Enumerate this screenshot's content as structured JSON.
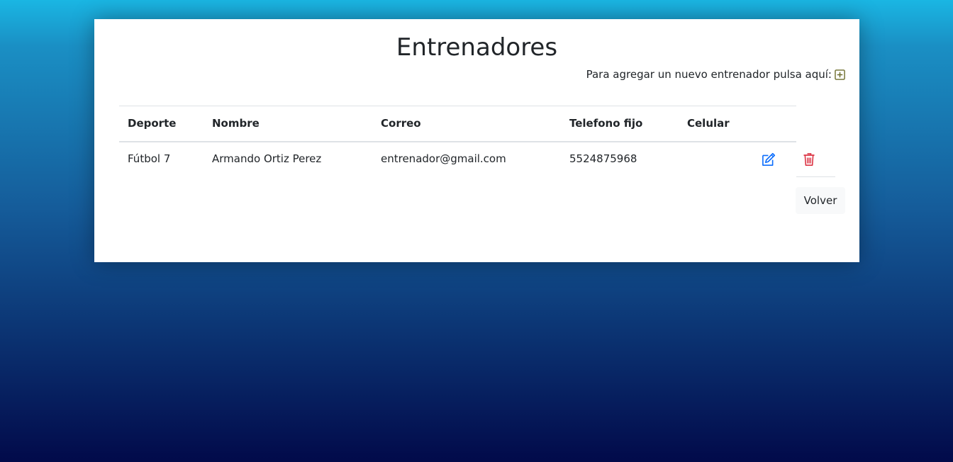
{
  "page": {
    "title": "Entrenadores",
    "add_prompt": "Para agregar un nuevo entrenador pulsa aquí:"
  },
  "table": {
    "headers": [
      "Deporte",
      "Nombre",
      "Correo",
      "Telefono fijo",
      "Celular"
    ],
    "rows": [
      [
        "Fútbol 7",
        "Armando Ortiz Perez",
        "entrenador@gmail.com",
        "5524875968",
        ""
      ]
    ]
  },
  "icons": {
    "add": "plus-square-icon",
    "edit": "pencil-square-icon",
    "delete": "trash-icon"
  },
  "colors": {
    "add_icon": "#6b6b2a",
    "edit_icon": "#0d6efd",
    "delete_icon": "#dc3545"
  },
  "buttons": {
    "back": "Volver"
  }
}
